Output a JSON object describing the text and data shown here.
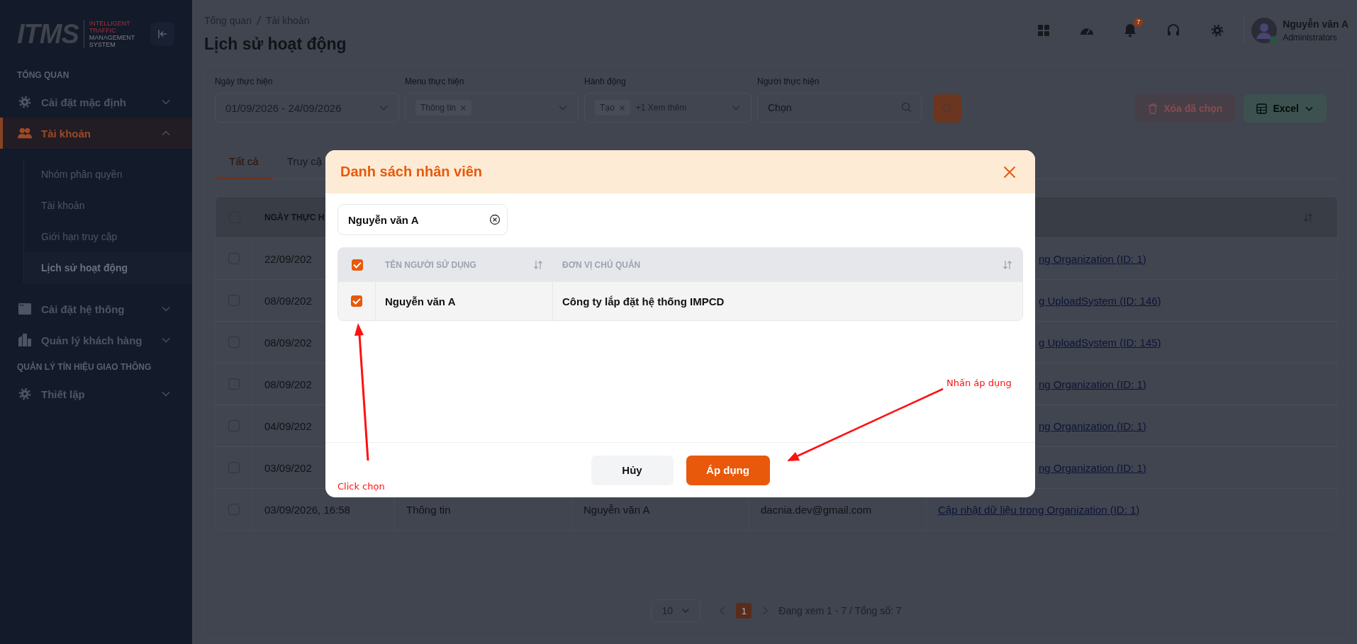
{
  "sidebar": {
    "logo": {
      "name": "ITMS",
      "tagline": [
        "INTELLIGENT",
        "TRAFFIC",
        "MANAGEMENT",
        "SYSTEM"
      ]
    },
    "groups": [
      {
        "title": "TỔNG QUAN",
        "items": [
          {
            "label": "Cài đặt mặc định",
            "selected": false,
            "expanded": false
          },
          {
            "label": "Tài khoản",
            "selected": true,
            "expanded": true,
            "children": [
              {
                "label": "Nhóm phân quyền",
                "selected": false
              },
              {
                "label": "Tài khoản",
                "selected": false
              },
              {
                "label": "Giới hạn truy cập",
                "selected": false
              },
              {
                "label": "Lịch sử hoạt động",
                "selected": true
              }
            ]
          },
          {
            "label": "Cài đặt hệ thống",
            "selected": false,
            "expanded": false
          },
          {
            "label": "Quản lý khách hàng",
            "selected": false,
            "expanded": false
          }
        ]
      },
      {
        "title": "QUẢN LÝ TÍN HIỆU GIAO THÔNG",
        "items": [
          {
            "label": "Thiết lập",
            "selected": false,
            "expanded": false
          }
        ]
      }
    ]
  },
  "header": {
    "breadcrumb": [
      "Tổng quan",
      "Tài khoản"
    ],
    "title": "Lịch sử hoạt động",
    "notification_count": "7",
    "user": {
      "name": "Nguyễn văn A",
      "role": "Administrators"
    }
  },
  "filters": [
    {
      "label": "Ngày thực hiện",
      "kind": "date",
      "value": "01/09/2026 - 24/09/2026"
    },
    {
      "label": "Menu thực hiện",
      "kind": "tags",
      "tags": [
        "Thông tin"
      ]
    },
    {
      "label": "Hành động",
      "kind": "tags",
      "tags": [
        "Tạo"
      ],
      "more": "+1 Xem thêm"
    },
    {
      "label": "Người thực hiện",
      "kind": "search",
      "placeholder": "Chọn"
    }
  ],
  "actions": [
    {
      "label": "Xóa đã chọn",
      "kind": "delete",
      "disabled": true
    },
    {
      "label": "Excel",
      "kind": "excel",
      "disabled": false
    }
  ],
  "tabs": [
    {
      "label": "Tất cả",
      "selected": true
    },
    {
      "label": "Truy cậ",
      "selected": false
    }
  ],
  "table": {
    "columns": [
      "NGÀY THỰC H"
    ],
    "all_checked": false,
    "rows": [
      {
        "checked": false,
        "date": "22/09/202",
        "link": "ng Organization (ID: 1)"
      },
      {
        "checked": false,
        "date": "08/09/202",
        "link": "g UploadSystem (ID: 146)"
      },
      {
        "checked": false,
        "date": "08/09/202",
        "link": "g UploadSystem (ID: 145)"
      },
      {
        "checked": false,
        "date": "08/09/202",
        "link": "ng Organization (ID: 1)"
      },
      {
        "checked": false,
        "date": "04/09/202",
        "link": "ng Organization (ID: 1)"
      },
      {
        "checked": false,
        "date": "03/09/202",
        "link": "ng Organization (ID: 1)"
      },
      {
        "checked": false,
        "date": "03/09/2026, 16:58",
        "type": "Thông tin",
        "user": "Nguyễn văn A",
        "email": "dacnia.dev@gmail.com",
        "link": "Cập nhật dữ liệu trong Organization (ID: 1)"
      }
    ]
  },
  "pagination": {
    "page_size": "10",
    "pages": [
      {
        "label": "1",
        "selected": true
      }
    ],
    "summary": "Đang xem 1 - 7 / Tổng số: 7"
  },
  "modal": {
    "title": "Danh sách nhân viên",
    "search": {
      "value": "Nguyễn văn A"
    },
    "columns": [
      "TÊN NGƯỜI SỬ DỤNG",
      "ĐƠN VỊ CHỦ QUẢN"
    ],
    "all_checked": true,
    "rows": [
      {
        "checked": true,
        "name": "Nguyễn văn A",
        "unit": "Công ty lắp đặt hệ thống IMPCD"
      }
    ],
    "buttons": [
      {
        "label": "Hủy",
        "kind": "secondary"
      },
      {
        "label": "Áp dụng",
        "kind": "primary"
      }
    ]
  },
  "annotations": [
    {
      "text": "Click chọn"
    },
    {
      "text": "Nhấn áp dụng"
    }
  ]
}
